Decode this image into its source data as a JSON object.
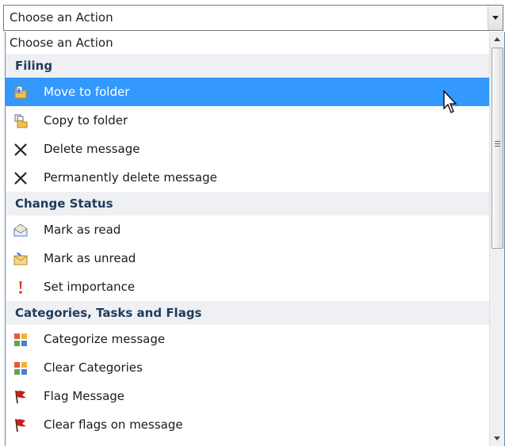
{
  "combo": {
    "selected_label": "Choose an Action"
  },
  "dropdown": {
    "top_item": "Choose an Action",
    "groups": [
      {
        "title": "Filing",
        "items": [
          {
            "label": "Move to folder",
            "icon": "move-folder-icon",
            "selected": true
          },
          {
            "label": "Copy to folder",
            "icon": "copy-folder-icon"
          },
          {
            "label": "Delete message",
            "icon": "delete-x-icon"
          },
          {
            "label": "Permanently delete message",
            "icon": "delete-x-icon"
          }
        ]
      },
      {
        "title": "Change Status",
        "items": [
          {
            "label": "Mark as read",
            "icon": "envelope-open-icon"
          },
          {
            "label": "Mark as unread",
            "icon": "envelope-closed-icon"
          },
          {
            "label": "Set importance",
            "icon": "exclamation-icon"
          }
        ]
      },
      {
        "title": "Categories, Tasks and Flags",
        "items": [
          {
            "label": "Categorize message",
            "icon": "categories-icon"
          },
          {
            "label": "Clear Categories",
            "icon": "categories-icon"
          },
          {
            "label": "Flag Message",
            "icon": "red-flag-icon"
          },
          {
            "label": "Clear flags on message",
            "icon": "red-flag-icon"
          }
        ]
      }
    ]
  },
  "colors": {
    "selection": "#3399ff",
    "group_header_bg": "#eef0f4",
    "group_header_text": "#1f3c5a"
  }
}
